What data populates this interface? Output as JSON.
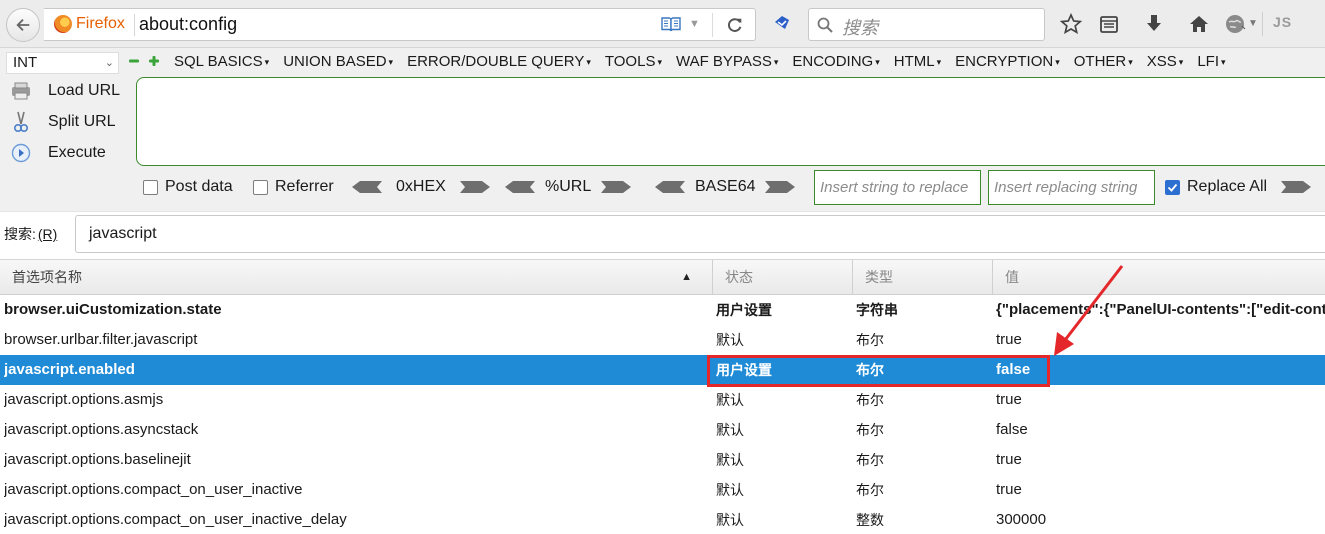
{
  "browser": {
    "brand": "Firefox",
    "url": "about:config",
    "search_placeholder": "搜索",
    "js_label": "JS",
    "accent_color": "#e66000"
  },
  "hackbar": {
    "encoding_select": "INT",
    "menu": [
      "SQL BASICS",
      "UNION BASED",
      "ERROR/DOUBLE QUERY",
      "TOOLS",
      "WAF BYPASS",
      "ENCODING",
      "HTML",
      "ENCRYPTION",
      "OTHER",
      "XSS",
      "LFI"
    ],
    "actions": {
      "load_url": "Load URL",
      "split_url": "Split URL",
      "execute": "Execute"
    },
    "post_data": "Post data",
    "referrer": "Referrer",
    "hex": "0xHEX",
    "url_enc": "%URL",
    "base64": "BASE64",
    "insert_placeholder": "Insert string to replace",
    "replacing_placeholder": "Insert replacing string",
    "replace_all": "Replace All",
    "replace_all_checked": true
  },
  "config": {
    "search_label": "搜索:",
    "search_accesskey": "(R)",
    "search_value": "javascript",
    "columns": {
      "name": "首选项名称",
      "status": "状态",
      "type": "类型",
      "value": "值"
    },
    "rows": [
      {
        "name": "browser.uiCustomization.state",
        "status": "用户设置",
        "type": "字符串",
        "value": "{\"placements\":{\"PanelUI-contents\":[\"edit-controls\"",
        "modified": true,
        "selected": false
      },
      {
        "name": "browser.urlbar.filter.javascript",
        "status": "默认",
        "type": "布尔",
        "value": "true",
        "modified": false,
        "selected": false
      },
      {
        "name": "javascript.enabled",
        "status": "用户设置",
        "type": "布尔",
        "value": "false",
        "modified": true,
        "selected": true
      },
      {
        "name": "javascript.options.asmjs",
        "status": "默认",
        "type": "布尔",
        "value": "true",
        "modified": false,
        "selected": false
      },
      {
        "name": "javascript.options.asyncstack",
        "status": "默认",
        "type": "布尔",
        "value": "false",
        "modified": false,
        "selected": false
      },
      {
        "name": "javascript.options.baselinejit",
        "status": "默认",
        "type": "布尔",
        "value": "true",
        "modified": false,
        "selected": false
      },
      {
        "name": "javascript.options.compact_on_user_inactive",
        "status": "默认",
        "type": "布尔",
        "value": "true",
        "modified": false,
        "selected": false
      },
      {
        "name": "javascript.options.compact_on_user_inactive_delay",
        "status": "默认",
        "type": "整数",
        "value": "300000",
        "modified": false,
        "selected": false
      }
    ],
    "selection_color": "#1f8bd6",
    "annotation_color": "#e3272a"
  }
}
